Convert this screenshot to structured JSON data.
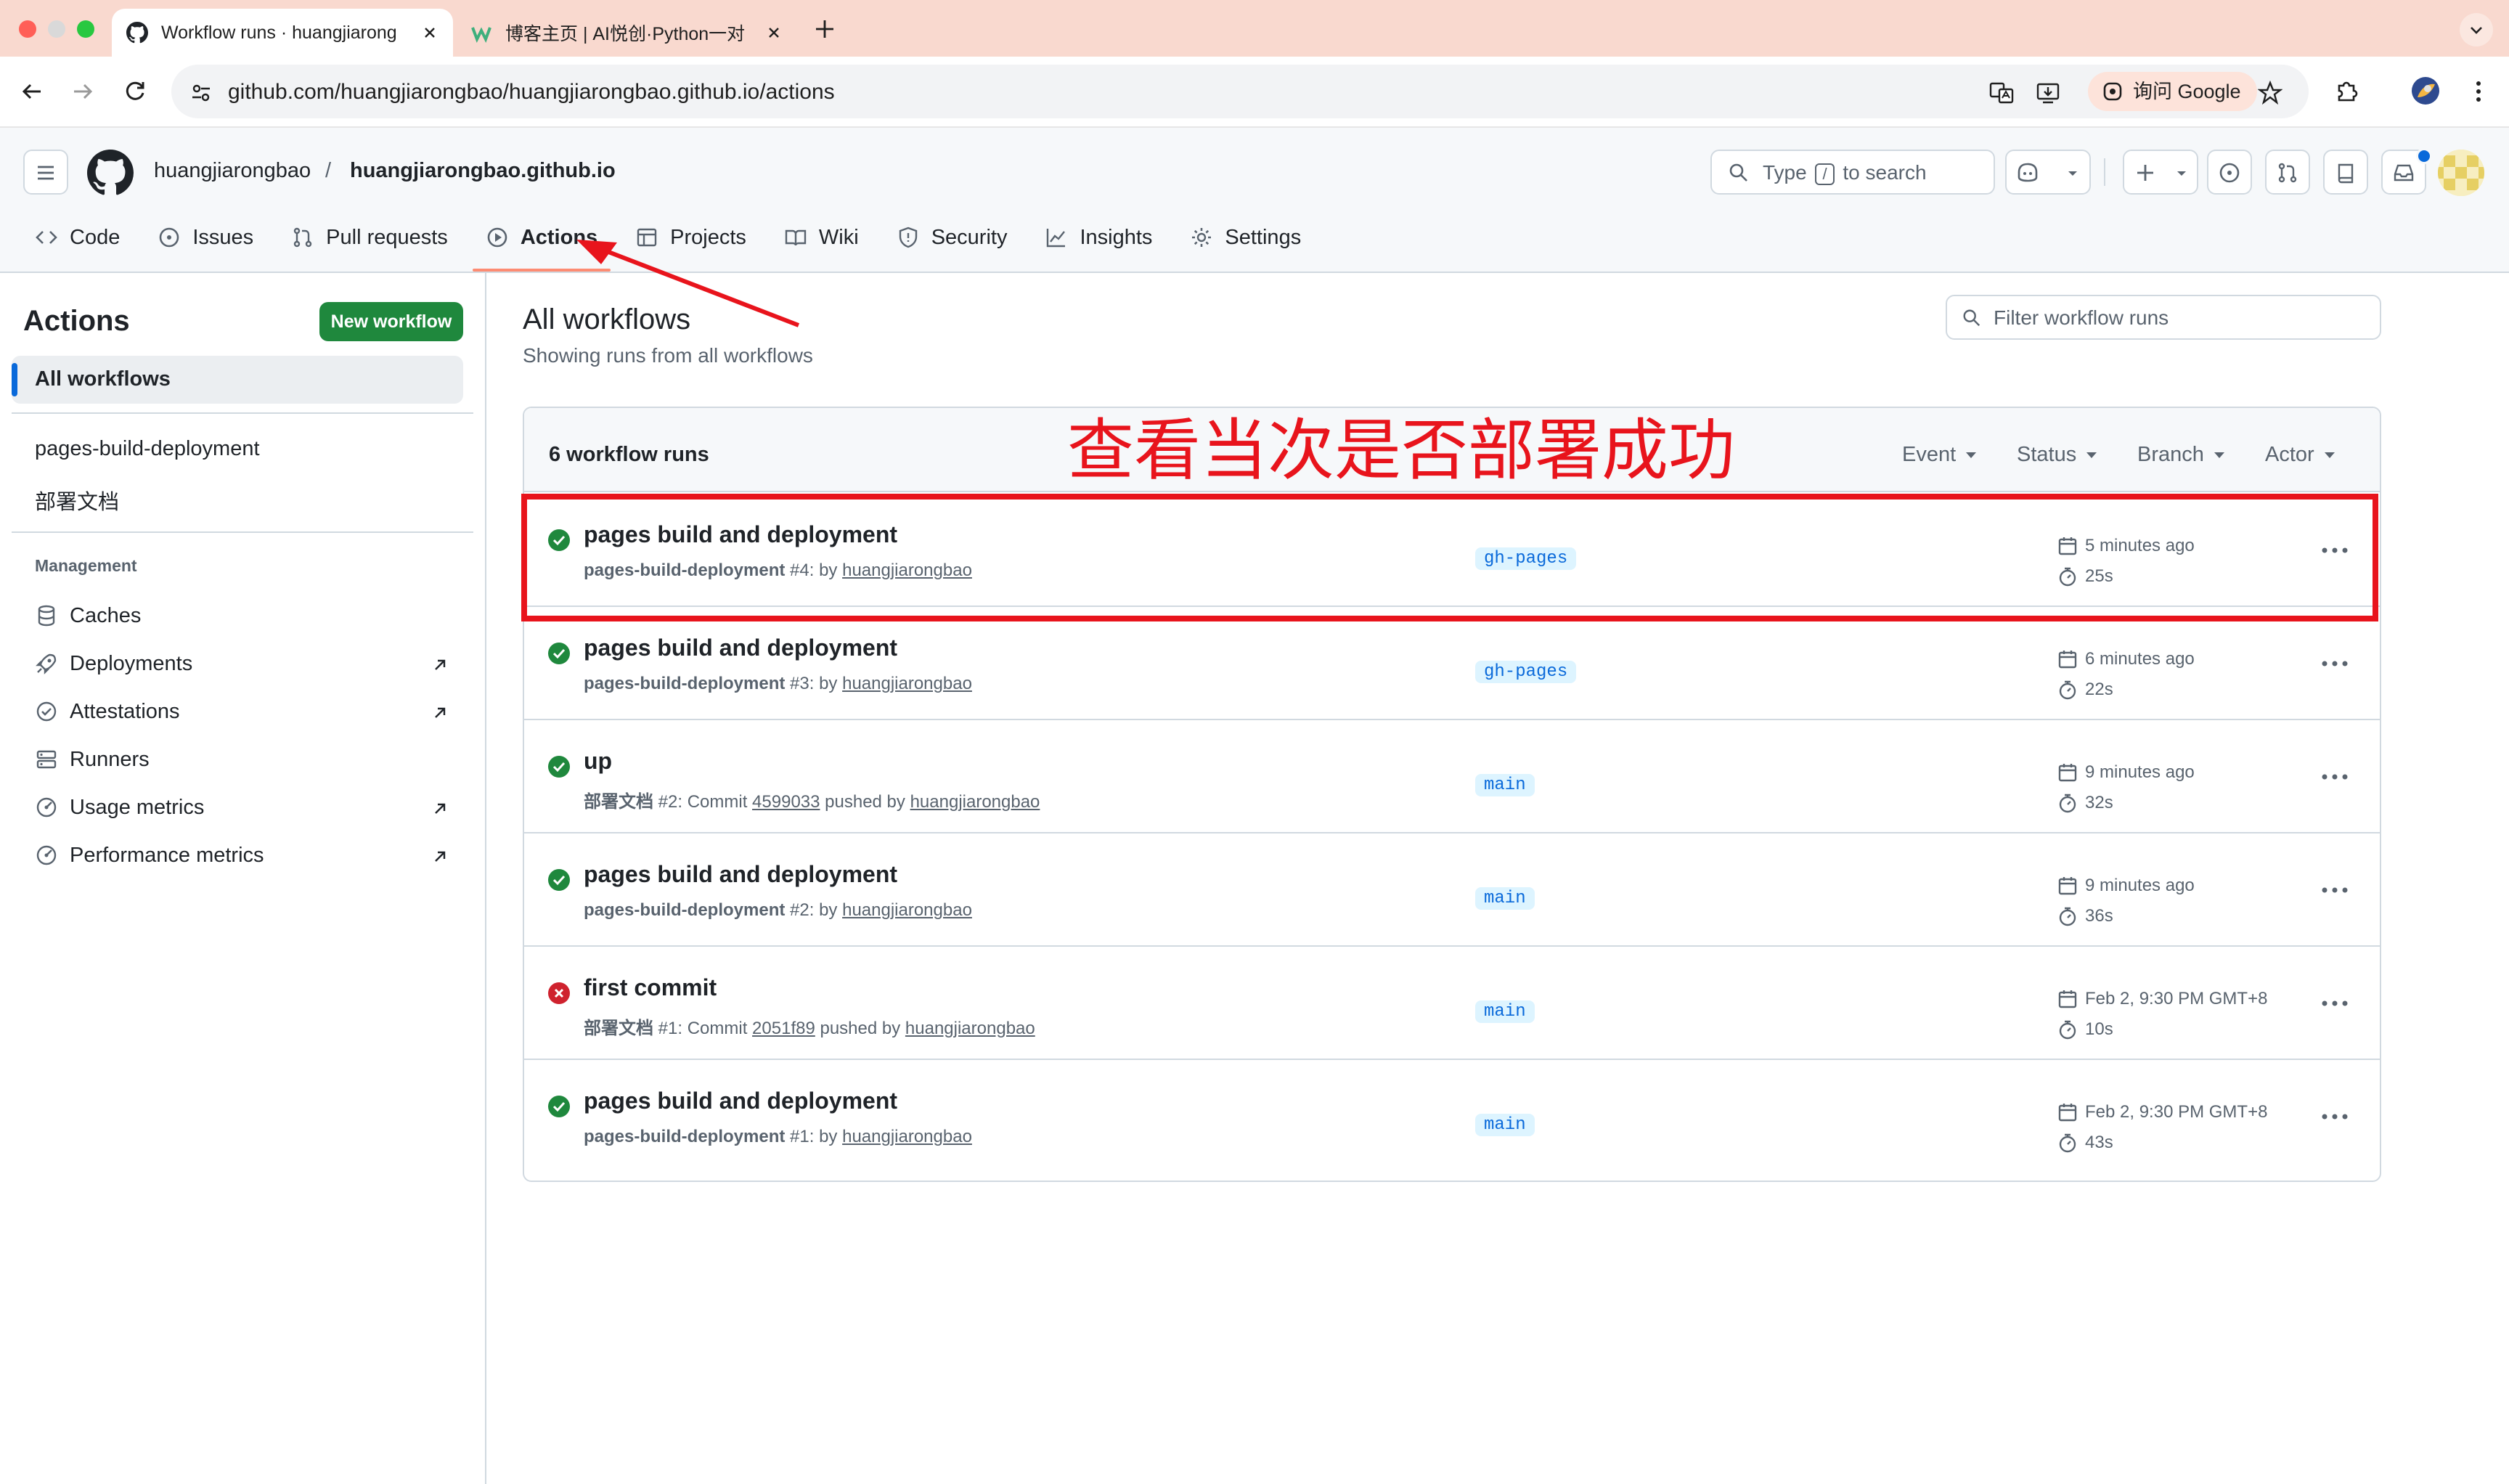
{
  "browser": {
    "tabs": [
      {
        "title": "Workflow runs · huangjiarong",
        "active": true
      },
      {
        "title": "博客主页 | AI悦创·Python一对",
        "active": false
      }
    ],
    "url": "github.com/huangjiarongbao/huangjiarongbao.github.io/actions",
    "ask_google": "询问 Google"
  },
  "header": {
    "owner": "huangjiarongbao",
    "separator": "/",
    "repo": "huangjiarongbao.github.io",
    "search": {
      "before": "Type",
      "key": "/",
      "after": "to search"
    }
  },
  "repo_nav": [
    {
      "label": "Code",
      "icon": "code-icon"
    },
    {
      "label": "Issues",
      "icon": "issue-icon"
    },
    {
      "label": "Pull requests",
      "icon": "pull-request-icon"
    },
    {
      "label": "Actions",
      "icon": "play-icon"
    },
    {
      "label": "Projects",
      "icon": "table-icon"
    },
    {
      "label": "Wiki",
      "icon": "book-icon"
    },
    {
      "label": "Security",
      "icon": "shield-icon"
    },
    {
      "label": "Insights",
      "icon": "graph-icon"
    },
    {
      "label": "Settings",
      "icon": "gear-icon"
    }
  ],
  "sidebar": {
    "title": "Actions",
    "new_workflow": "New workflow",
    "all_workflows": "All workflows",
    "workflows": [
      "pages-build-deployment",
      "部署文档"
    ],
    "management_heading": "Management",
    "management": [
      {
        "label": "Caches",
        "icon": "database-icon"
      },
      {
        "label": "Deployments",
        "icon": "rocket-icon"
      },
      {
        "label": "Attestations",
        "icon": "verified-icon"
      },
      {
        "label": "Runners",
        "icon": "server-icon"
      },
      {
        "label": "Usage metrics",
        "icon": "meter-icon"
      },
      {
        "label": "Performance metrics",
        "icon": "meter-icon"
      }
    ]
  },
  "main": {
    "title": "All workflows",
    "subtitle": "Showing runs from all workflows",
    "filter_placeholder": "Filter workflow runs",
    "runs_count": "6 workflow runs",
    "filters": [
      "Event",
      "Status",
      "Branch",
      "Actor"
    ],
    "runs": [
      {
        "status": "success",
        "title": "pages build and deployment",
        "workflow": "pages-build-deployment",
        "number": "#4",
        "text": ": by ",
        "commit": "",
        "actor": "huangjiarongbao",
        "branch": "gh-pages",
        "time": "5 minutes ago",
        "duration": "25s"
      },
      {
        "status": "success",
        "title": "pages build and deployment",
        "workflow": "pages-build-deployment",
        "number": "#3",
        "text": ": by ",
        "commit": "",
        "actor": "huangjiarongbao",
        "branch": "gh-pages",
        "time": "6 minutes ago",
        "duration": "22s"
      },
      {
        "status": "success",
        "title": "up",
        "workflow": "部署文档",
        "number": "#2",
        "text": ": Commit ",
        "commit": "4599033",
        "actor": "huangjiarongbao",
        "branch": "main",
        "time": "9 minutes ago",
        "duration": "32s"
      },
      {
        "status": "success",
        "title": "pages build and deployment",
        "workflow": "pages-build-deployment",
        "number": "#2",
        "text": ": by ",
        "commit": "",
        "actor": "huangjiarongbao",
        "branch": "main",
        "time": "9 minutes ago",
        "duration": "36s"
      },
      {
        "status": "failure",
        "title": "first commit",
        "workflow": "部署文档",
        "number": "#1",
        "text": ": Commit ",
        "commit": "2051f89",
        "actor": "huangjiarongbao",
        "branch": "main",
        "time": "Feb 2, 9:30 PM GMT+8",
        "duration": "10s"
      },
      {
        "status": "success",
        "title": "pages build and deployment",
        "workflow": "pages-build-deployment",
        "number": "#1",
        "text": ": by ",
        "commit": "",
        "actor": "huangjiarongbao",
        "branch": "main",
        "time": "Feb 2, 9:30 PM GMT+8",
        "duration": "43s"
      }
    ]
  },
  "annotation": {
    "text": "查看当次是否部署成功",
    "color": "#e8141c"
  },
  "colors": {
    "accent": "#0969da",
    "success": "#1f883d",
    "failure": "#cf222e",
    "nav_underline": "#fd8c73"
  }
}
